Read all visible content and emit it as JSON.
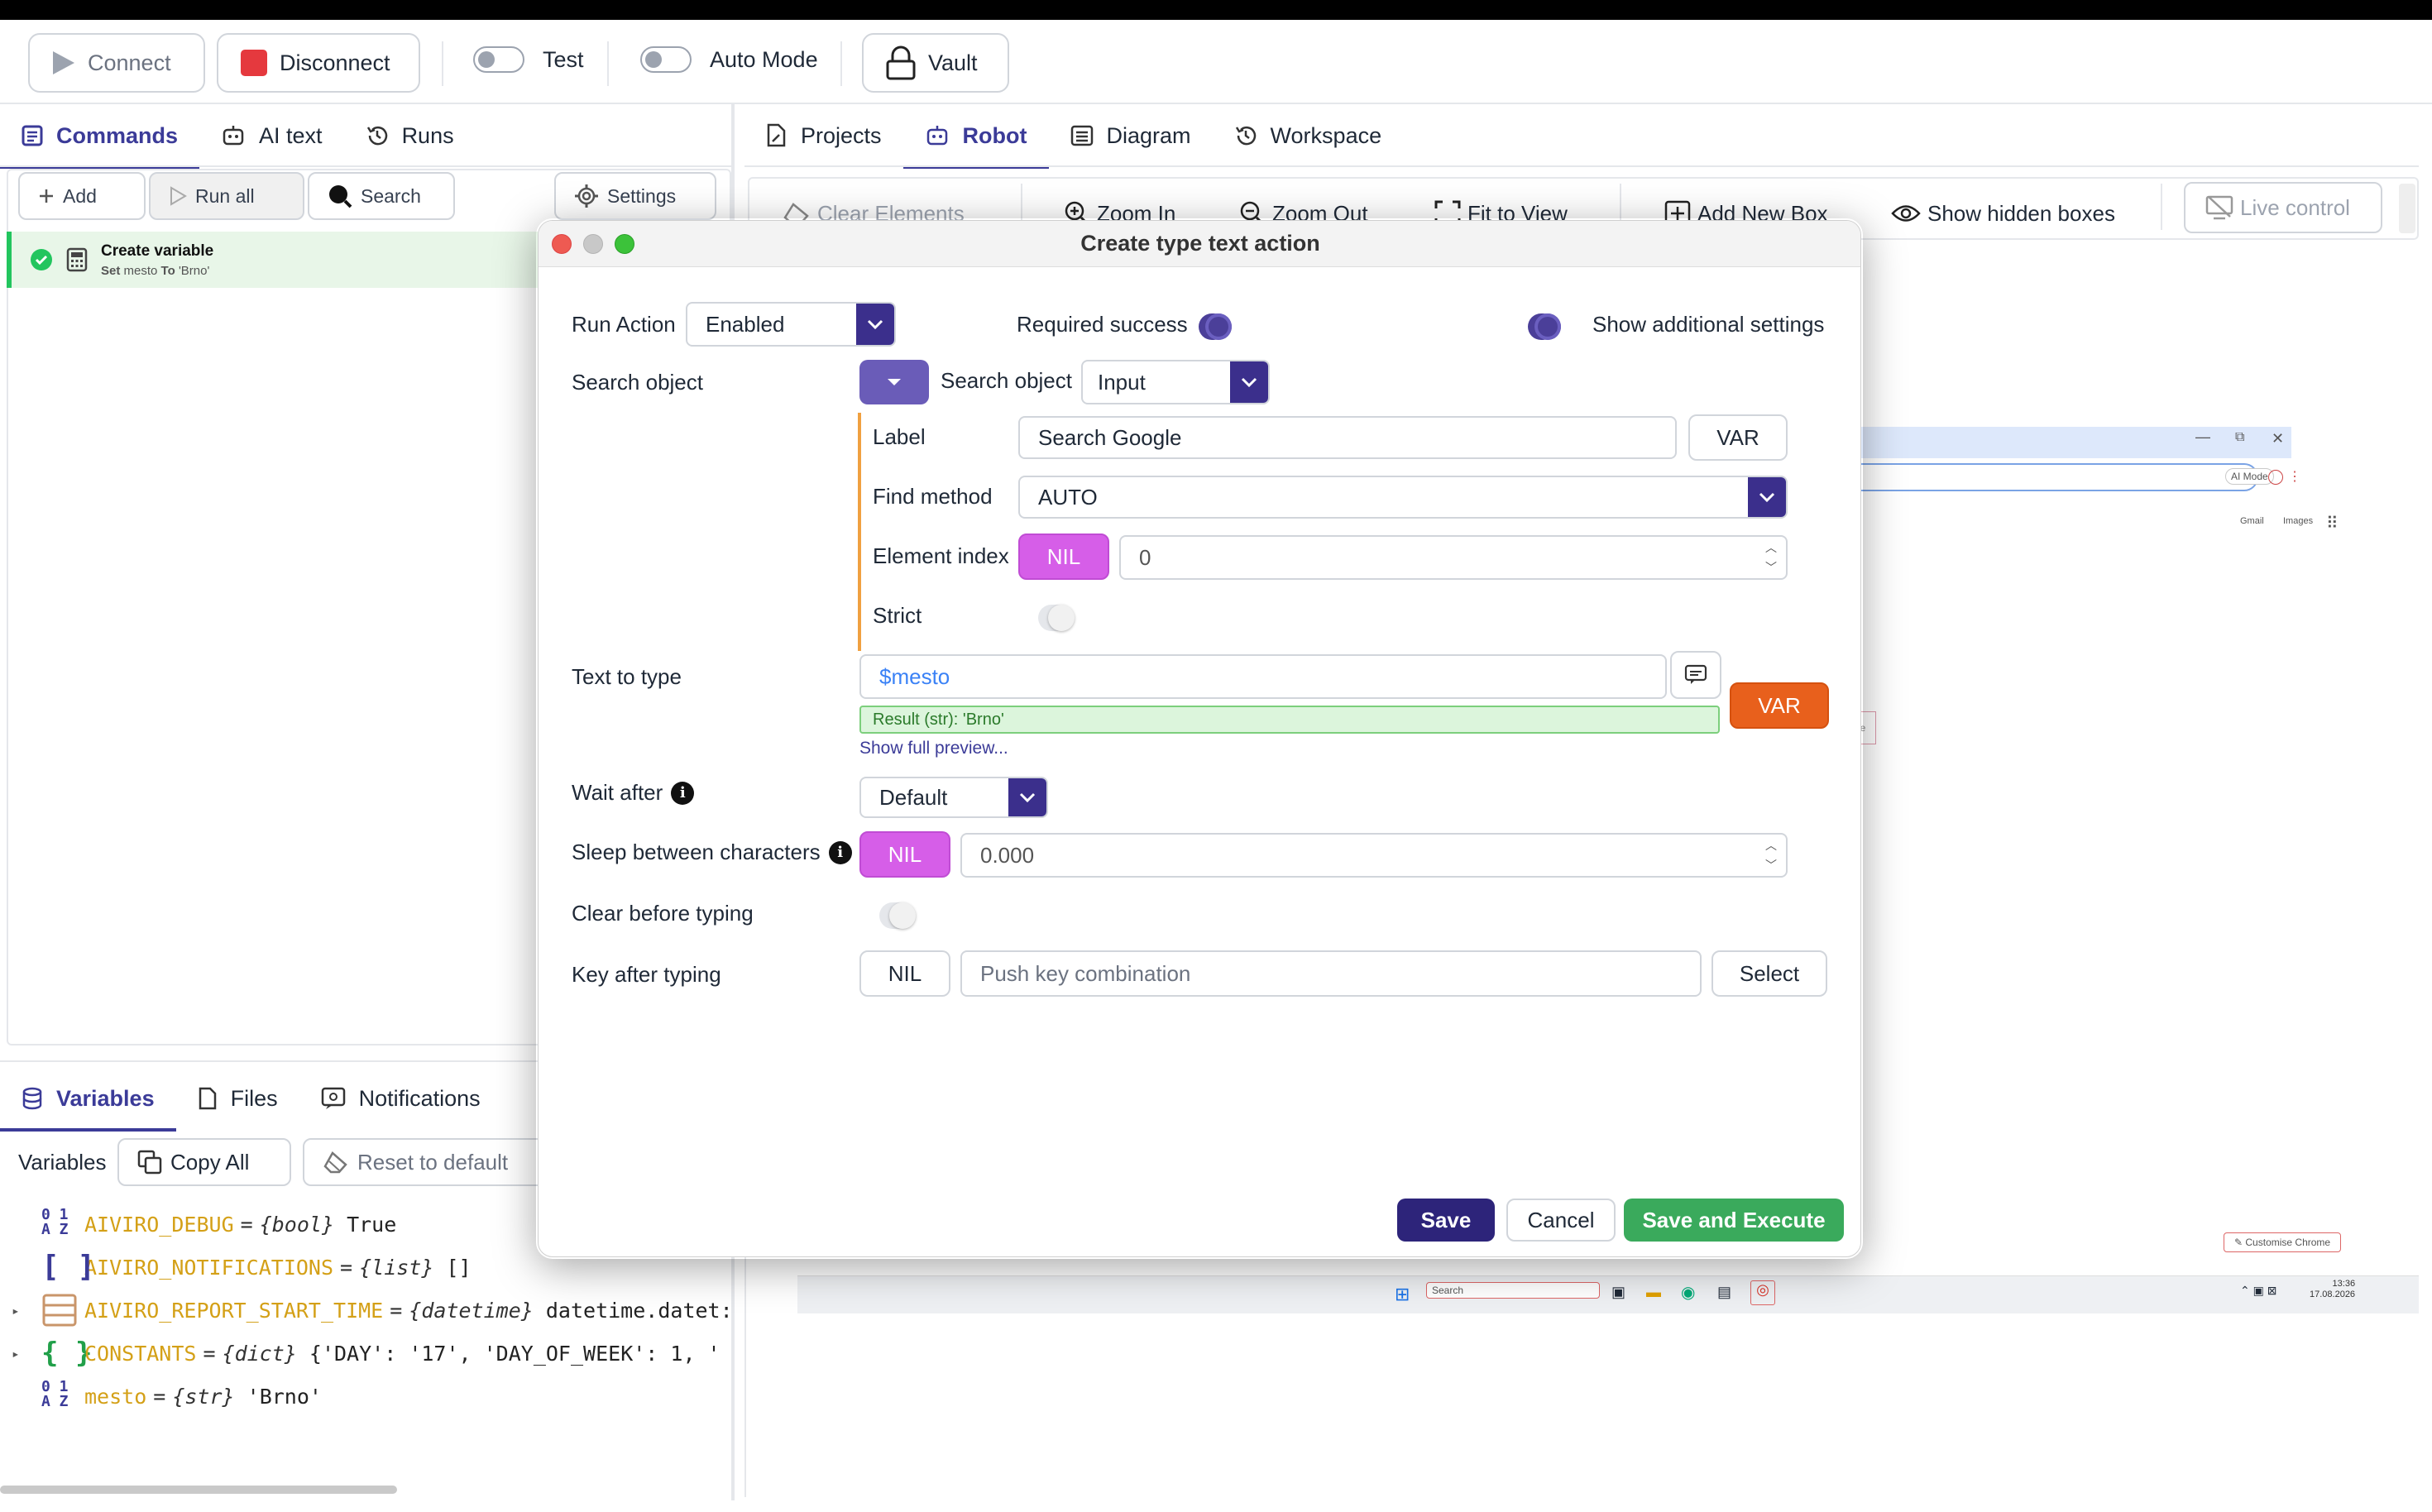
{
  "toolbar": {
    "connect": "Connect",
    "disconnect": "Disconnect",
    "test": "Test",
    "auto_mode": "Auto Mode",
    "vault": "Vault"
  },
  "left_tabs": {
    "commands": "Commands",
    "ai_text": "AI text",
    "runs": "Runs"
  },
  "commands_toolbar": {
    "add": "Add",
    "run_all": "Run all",
    "search": "Search",
    "settings": "Settings"
  },
  "commands": [
    {
      "title": "Create variable",
      "set": "Set",
      "var": "mesto",
      "to": "To",
      "value": "'Brno'"
    }
  ],
  "bottom_tabs": {
    "variables": "Variables",
    "files": "Files",
    "notifications": "Notifications"
  },
  "variables_toolbar": {
    "label": "Variables",
    "copy_all": "Copy All",
    "reset": "Reset to default"
  },
  "variables": [
    {
      "name": "AIVIRO_DEBUG",
      "type": "{bool}",
      "value": "True"
    },
    {
      "name": "AIVIRO_NOTIFICATIONS",
      "type": "{list}",
      "value": "[]"
    },
    {
      "name": "AIVIRO_REPORT_START_TIME",
      "type": "{datetime}",
      "value": "datetime.datet:"
    },
    {
      "name": "CONSTANTS",
      "type": "{dict}",
      "value": "{'DAY': '17', 'DAY_OF_WEEK': 1, '"
    },
    {
      "name": "mesto",
      "type": "{str}",
      "value": "'Brno'"
    }
  ],
  "right_tabs": {
    "projects": "Projects",
    "robot": "Robot",
    "diagram": "Diagram",
    "workspace": "Workspace"
  },
  "robot_toolbar": {
    "clear_elements": "Clear Elements",
    "zoom_in": "Zoom In",
    "zoom_out": "Zoom Out",
    "fit_to_view": "Fit to View",
    "add_new_box": "Add New Box",
    "show_hidden_boxes": "Show hidden boxes",
    "live_control": "Live control"
  },
  "preview": {
    "ai_mode": "AI Mode",
    "gmail": "Gmail",
    "images": "Images",
    "customise_chrome": "Customise Chrome",
    "taskbar_search": "Search",
    "time": "13:36",
    "date": "17.08.2026",
    "partial_text": "de"
  },
  "dialog": {
    "title": "Create type text action",
    "run_action_label": "Run Action",
    "run_action_value": "Enabled",
    "required_success": "Required success",
    "show_additional": "Show additional settings",
    "search_object_label": "Search object",
    "search_object_inner": "Search object",
    "search_object_value": "Input",
    "label_label": "Label",
    "label_value": "Search Google",
    "var": "VAR",
    "find_method_label": "Find method",
    "find_method_value": "AUTO",
    "element_index_label": "Element index",
    "nil": "NIL",
    "element_index_value": "0",
    "strict_label": "Strict",
    "text_to_type_label": "Text to type",
    "text_to_type_value": "$mesto",
    "result": "Result (str): 'Brno'",
    "show_full_preview": "Show full preview...",
    "wait_after_label": "Wait after",
    "wait_after_value": "Default",
    "sleep_label": "Sleep between characters",
    "sleep_value": "0.000",
    "clear_before_label": "Clear before typing",
    "key_after_label": "Key after typing",
    "key_placeholder": "Push key combination",
    "select": "Select",
    "save": "Save",
    "cancel": "Cancel",
    "save_execute": "Save and Execute"
  },
  "colors": {
    "accent": "#3b2f8c",
    "nil": "#d65ee8",
    "var_orange": "#e8601c",
    "save_green": "#34a853",
    "success": "#22c55e"
  }
}
